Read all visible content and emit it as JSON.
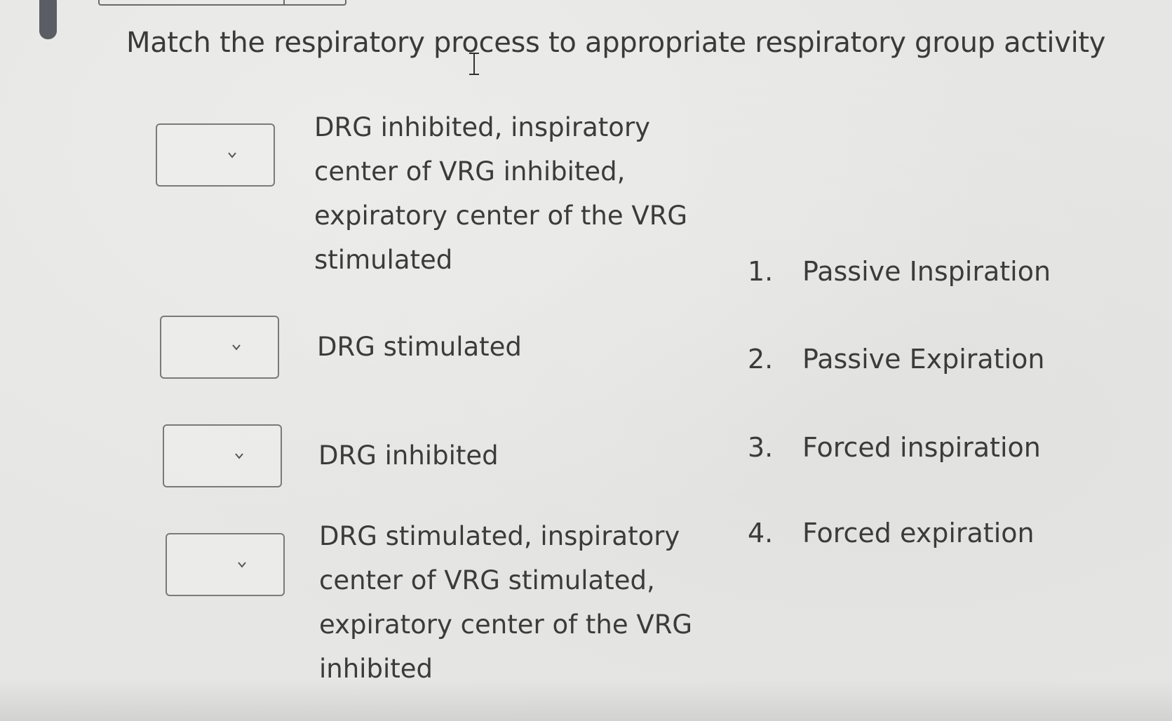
{
  "question": {
    "title": "Match the respiratory process to appropriate respiratory group activity"
  },
  "premises": [
    {
      "lines": [
        "DRG inhibited, inspiratory",
        "center of VRG inhibited,",
        "expiratory center of the VRG",
        "stimulated"
      ],
      "selected": ""
    },
    {
      "lines": [
        "DRG stimulated"
      ],
      "selected": ""
    },
    {
      "lines": [
        "DRG inhibited"
      ],
      "selected": ""
    },
    {
      "lines": [
        "DRG stimulated, inspiratory",
        "center of VRG stimulated,",
        "expiratory center of the VRG",
        "inhibited"
      ],
      "selected": ""
    }
  ],
  "answers": [
    {
      "number": "1.",
      "label": "Passive Inspiration"
    },
    {
      "number": "2.",
      "label": "Passive Expiration"
    },
    {
      "number": "3.",
      "label": "Forced inspiration"
    },
    {
      "number": "4.",
      "label": "Forced expiration"
    }
  ],
  "icons": {
    "dropdown": "chevron-down-icon",
    "cursor": "text-cursor-icon"
  }
}
